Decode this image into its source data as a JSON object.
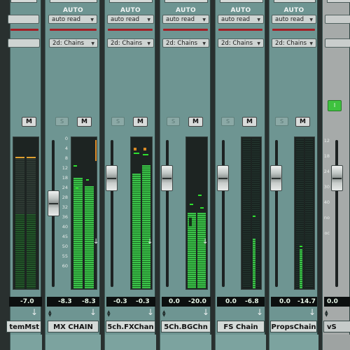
{
  "mixer": {
    "strips": [
      {
        "name": "temMst",
        "automation": "",
        "automation_mode": "",
        "insert": "",
        "solo": "",
        "mute": "M",
        "vol": "",
        "peak": "-7.0"
      },
      {
        "name": "MX CHAIN",
        "automation": "AUTO",
        "automation_mode": "auto read",
        "insert": "2d: Chains",
        "solo": "S",
        "mute": "M",
        "vol": "-8.3",
        "peak": "-8.3"
      },
      {
        "name": "5ch.FXChan",
        "automation": "AUTO",
        "automation_mode": "auto read",
        "insert": "2d: Chains",
        "solo": "S",
        "mute": "M",
        "vol": "-0.3",
        "peak": "-0.3"
      },
      {
        "name": "5Ch.BGChn",
        "automation": "AUTO",
        "automation_mode": "auto read",
        "insert": "2d: Chains",
        "solo": "S",
        "mute": "M",
        "vol": "0.0",
        "peak": "-20.0"
      },
      {
        "name": "FS Chain",
        "automation": "AUTO",
        "automation_mode": "auto read",
        "insert": "2d: Chains",
        "solo": "S",
        "mute": "M",
        "vol": "0.0",
        "peak": "-6.8"
      },
      {
        "name": "PropsChain",
        "automation": "AUTO",
        "automation_mode": "auto read",
        "insert": "2d: Chains",
        "solo": "S",
        "mute": "M",
        "vol": "0.0",
        "peak": "-14.7"
      },
      {
        "name": "vS",
        "automation": "",
        "automation_mode": "",
        "insert": "",
        "solo": "",
        "mute": "I",
        "vol": "0.0",
        "peak": ""
      }
    ],
    "scale_marks": [
      "0",
      "4",
      "8",
      "12",
      "18",
      "24",
      "28",
      "32",
      "36",
      "40",
      "45",
      "50",
      "55",
      "60"
    ],
    "scale_marks_last": [
      "12",
      "18",
      "24",
      "30",
      "40",
      "no",
      "oc"
    ],
    "colors": {
      "strip": "#6e9592",
      "meter_green": "#3cc24a",
      "clip_orange": "#d98a27",
      "automation_red": "#a51e24",
      "input_green": "#3ec23e"
    }
  }
}
